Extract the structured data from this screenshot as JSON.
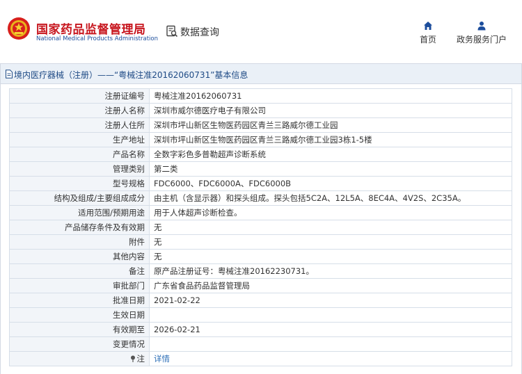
{
  "header": {
    "logo_cn": "国家药品监督管理局",
    "logo_en": "National Medical Products Administration",
    "data_query": "数据查询",
    "nav": {
      "home": "首页",
      "portal": "政务服务门户"
    }
  },
  "panel": {
    "title": "境内医疗器械（注册）——“粤械注准20162060731”基本信息"
  },
  "rows": [
    {
      "label": "注册证编号",
      "value": "粤械注准20162060731"
    },
    {
      "label": "注册人名称",
      "value": "深圳市威尔德医疗电子有限公司"
    },
    {
      "label": "注册人住所",
      "value": "深圳市坪山新区生物医药园区青兰三路威尔德工业园"
    },
    {
      "label": "生产地址",
      "value": "深圳市坪山新区生物医药园区青兰三路威尔德工业园3栋1-5楼"
    },
    {
      "label": "产品名称",
      "value": "全数字彩色多普勒超声诊断系统"
    },
    {
      "label": "管理类别",
      "value": "第二类"
    },
    {
      "label": "型号规格",
      "value": "FDC6000、FDC6000A、FDC6000B"
    },
    {
      "label": "结构及组成/主要组成成分",
      "value": "由主机（含显示器）和探头组成。探头包括5C2A、12L5A、8EC4A、4V2S、2C35A。"
    },
    {
      "label": "适用范围/预期用途",
      "value": "用于人体超声诊断检查。"
    },
    {
      "label": "产品储存条件及有效期",
      "value": "无"
    },
    {
      "label": "附件",
      "value": "无"
    },
    {
      "label": "其他内容",
      "value": "无"
    },
    {
      "label": "备注",
      "value": "原产品注册证号：粤械注准20162230731。"
    },
    {
      "label": "审批部门",
      "value": "广东省食品药品监督管理局"
    },
    {
      "label": "批准日期",
      "value": "2021-02-22"
    },
    {
      "label": "生效日期",
      "value": ""
    },
    {
      "label": "有效期至",
      "value": "2026-02-21"
    },
    {
      "label": "变更情况",
      "value": ""
    },
    {
      "label": "注",
      "value": "详情"
    }
  ],
  "colors": {
    "brand_red": "#c7161e",
    "brand_blue": "#1c4d9c",
    "link": "#2e6fb7",
    "panel_head_bg": "#eaf0f7"
  },
  "icons": {
    "emblem": "national-emblem-icon",
    "data_query": "document-search-icon",
    "home": "home-icon",
    "portal": "user-icon",
    "panel": "document-icon",
    "note": "pin-icon"
  }
}
